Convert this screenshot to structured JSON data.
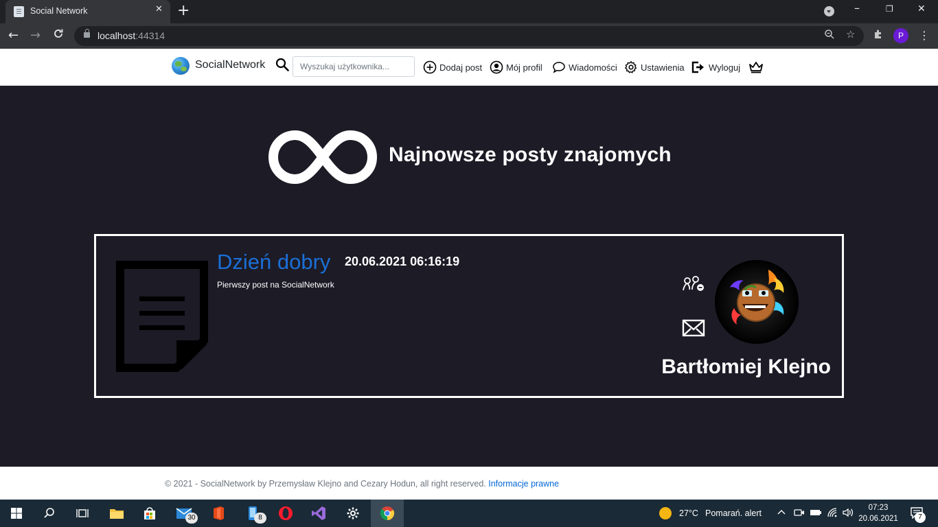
{
  "browser": {
    "tab_title": "Social Network",
    "tab_close": "✕",
    "new_tab": "+",
    "url_host": "localhost",
    "url_port": ":44314",
    "profile_initial": "P"
  },
  "navbar": {
    "brand": "SocialNetwork",
    "search_placeholder": "Wyszukaj użytkownika...",
    "links": {
      "add_post": "Dodaj post",
      "my_profile": "Mój profil",
      "messages": "Wiadomości",
      "settings": "Ustawienia",
      "logout": "Wyloguj"
    }
  },
  "main": {
    "heading": "Najnowsze posty znajomych",
    "posts": [
      {
        "title": "Dzień dobry",
        "date": "20.06.2021 06:16:19",
        "body": "Pierwszy post na SocialNetwork",
        "author": "Bartłomiej Klejno"
      }
    ]
  },
  "footer": {
    "text": "© 2021 - SocialNetwork by Przemysław Klejno and Cezary Hodun, all right reserved.",
    "link": "Informacje prawne"
  },
  "taskbar": {
    "mail_badge": "30",
    "phone_badge": "8",
    "weather_temp": "27°C",
    "weather_text": "Pomarań. alert",
    "time": "07:23",
    "date": "20.06.2021",
    "notifications": "7"
  },
  "colors": {
    "page_bg": "#1c1b26",
    "post_title": "#1b6fd6",
    "link": "#0366d6"
  }
}
